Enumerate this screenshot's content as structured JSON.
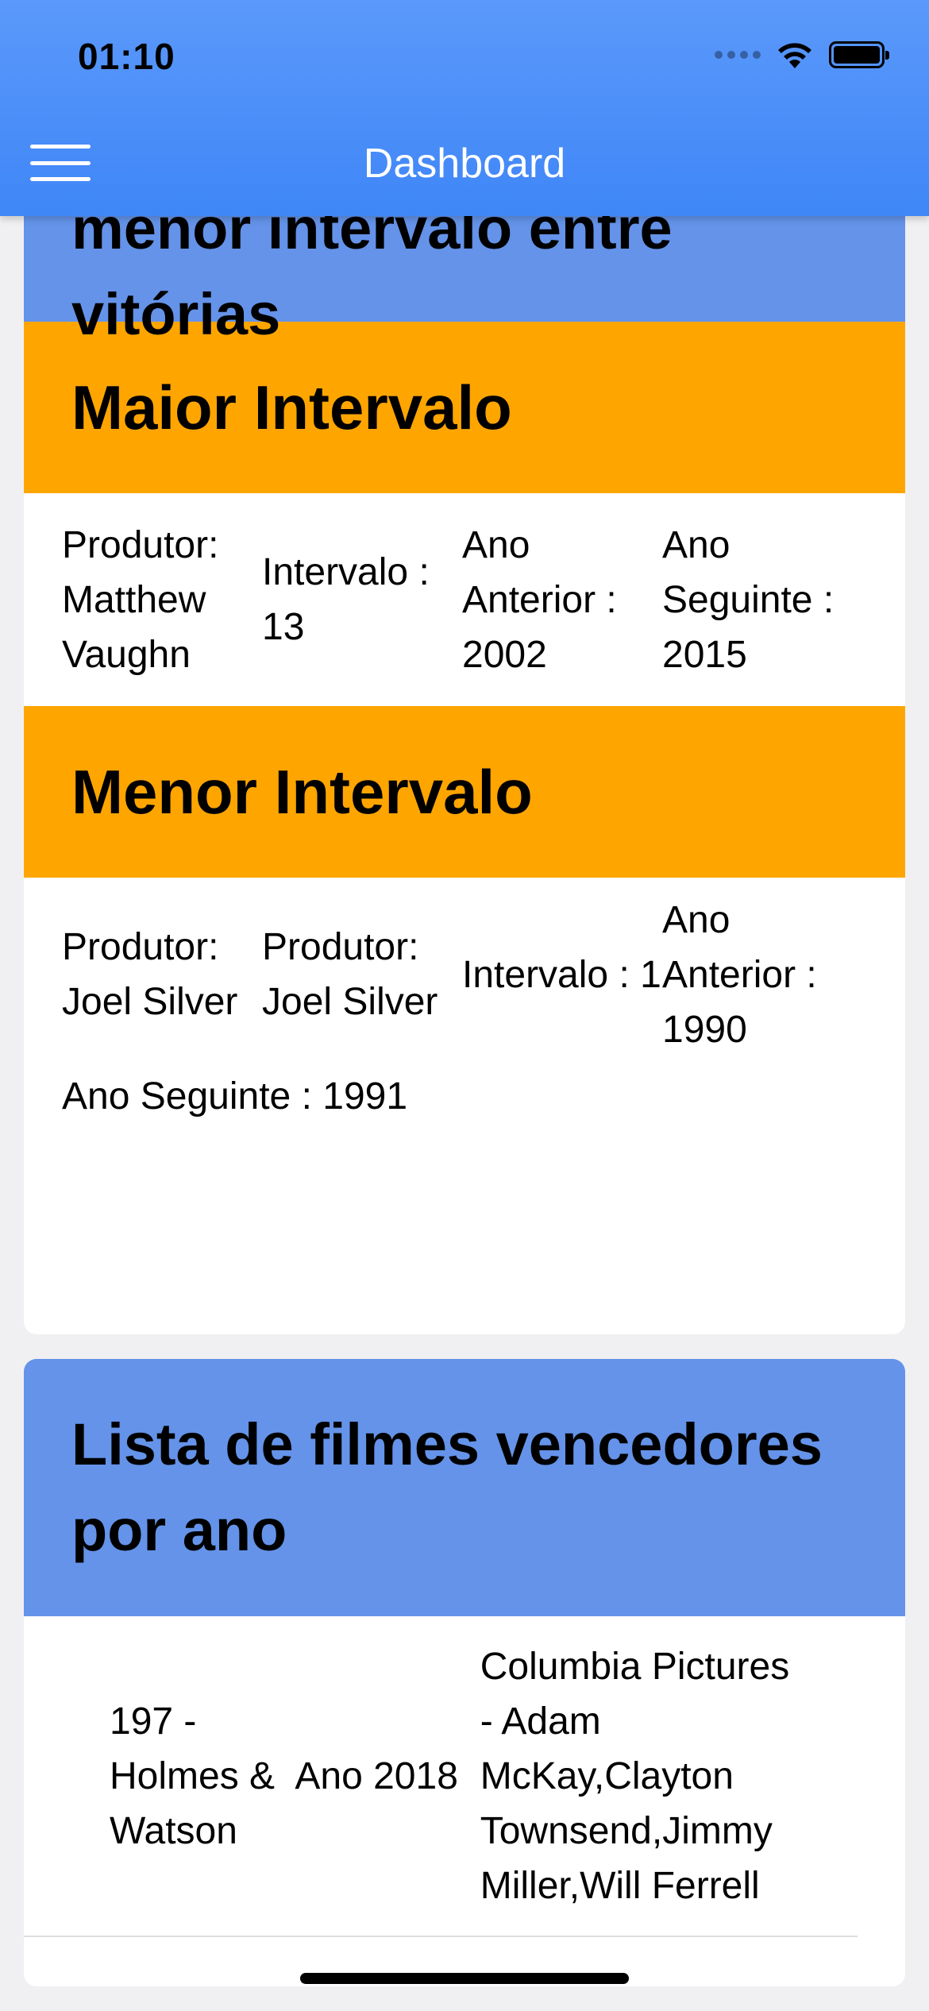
{
  "status_bar": {
    "time": "01:10"
  },
  "nav": {
    "title": "Dashboard"
  },
  "producers_card": {
    "title": "Produtores com maior e menor intervalo entre vitórias",
    "max": {
      "heading": "Maior Intervalo",
      "producer": "Produtor: Matthew Vaughn",
      "interval": "Intervalo : 13",
      "previous": "Ano Anterior : 2002",
      "following": "Ano Seguinte : 2015"
    },
    "min": {
      "heading": "Menor Intervalo",
      "producer_1": "Produtor: Joel Silver",
      "producer_2": "Produtor: Joel Silver",
      "interval": "Intervalo : 1",
      "previous": "Ano Anterior : 1990",
      "following": "Ano Seguinte : 1991"
    }
  },
  "winners_card": {
    "title": "Lista de filmes vencedores por ano",
    "rows": [
      {
        "film": "197 - Holmes & Watson",
        "year": "Ano 2018",
        "studio": "Columbia Pictures - Adam McKay,Clayton Townsend,Jimmy Miller,Will Ferrell"
      }
    ]
  }
}
